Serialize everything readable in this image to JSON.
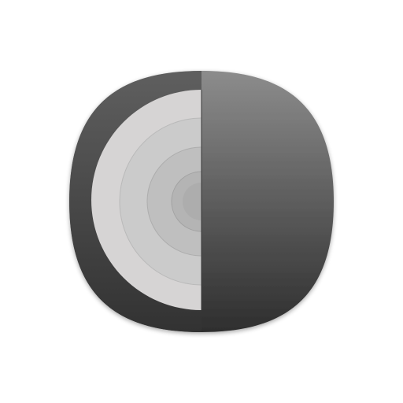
{
  "icon": {
    "name": "half-concentric-rings-app-icon",
    "colors": {
      "background": "#ffffff",
      "body_top": "#8c8c8c",
      "body_bottom": "#2e2e2e",
      "left_rim_top": "#5f5f5f",
      "left_rim_bottom": "#323232",
      "ring_1": "#d6d4d4",
      "ring_2": "#cbcbcb",
      "ring_3": "#bfbfbf",
      "ring_4": "#b4b4b4",
      "ring_5": "#a9a9a9"
    }
  }
}
